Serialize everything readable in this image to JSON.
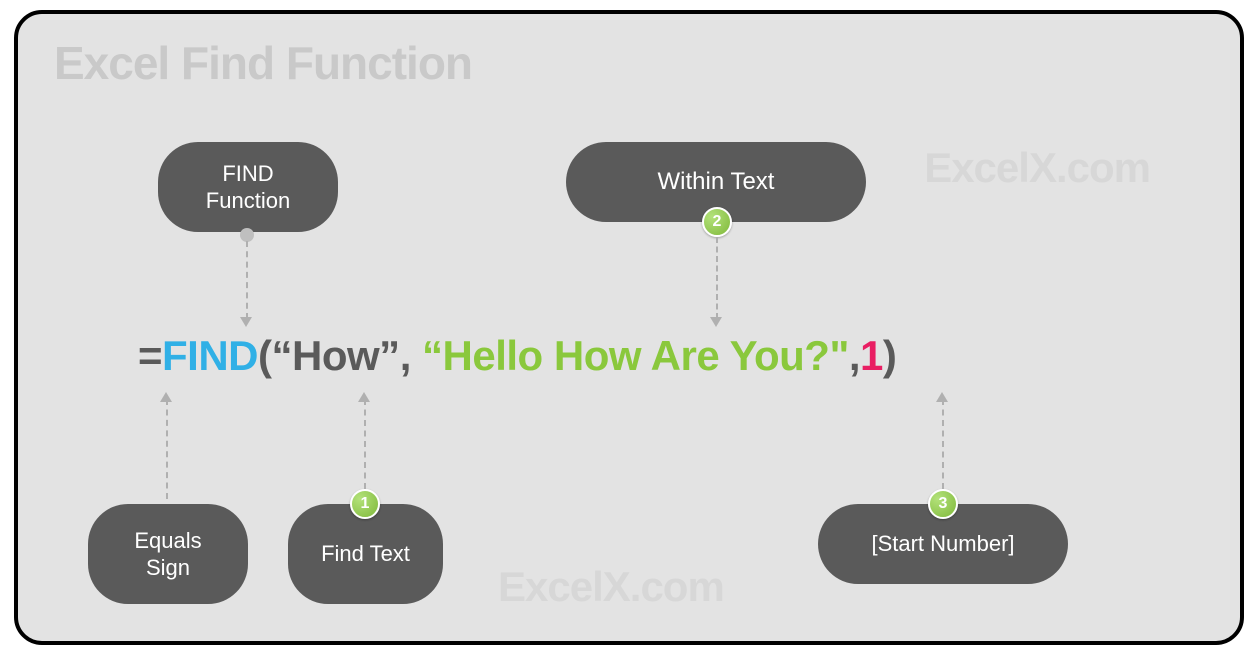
{
  "title": "Excel Find Function",
  "watermark": "ExcelX.com",
  "formula": {
    "equals": "=",
    "func": "FIND",
    "open": "(",
    "arg1": "“How”",
    "comma1": ", ",
    "arg2": "“Hello How Are You?\"",
    "comma2": ",",
    "arg3": "1",
    "close": ")"
  },
  "callouts": {
    "findfn": "FIND Function",
    "within": "Within Text",
    "equals": "Equals Sign",
    "findtext": "Find Text",
    "startnum": "[Start Number]"
  },
  "badges": {
    "within": "2",
    "findtext": "1",
    "startnum": "3"
  },
  "colors": {
    "bg": "#e3e3e3",
    "callout": "#5a5a5a",
    "func": "#30b0e6",
    "arg2": "#8ac83c",
    "arg3": "#e91e63",
    "badge": "#8ac83c"
  }
}
